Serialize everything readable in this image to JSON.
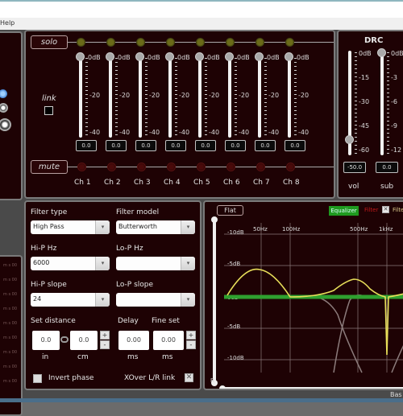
{
  "menu": {
    "help": "Help"
  },
  "mixer": {
    "solo_label": "solo",
    "mute_label": "mute",
    "link_label": "link",
    "scale": [
      "0dB",
      "-20",
      "-40"
    ],
    "channels": [
      {
        "name": "Ch 1",
        "value": "0.0",
        "level_db": 0
      },
      {
        "name": "Ch 2",
        "value": "0.0",
        "level_db": 0
      },
      {
        "name": "Ch 3",
        "value": "0.0",
        "level_db": 0
      },
      {
        "name": "Ch 4",
        "value": "0.0",
        "level_db": 0
      },
      {
        "name": "Ch 5",
        "value": "0.0",
        "level_db": 0
      },
      {
        "name": "Ch 6",
        "value": "0.0",
        "level_db": 0
      },
      {
        "name": "Ch 7",
        "value": "0.0",
        "level_db": 0
      },
      {
        "name": "Ch 8",
        "value": "0.0",
        "level_db": 0
      }
    ]
  },
  "drc": {
    "title": "DRC",
    "vol": {
      "label": "vol",
      "value": "-50.0",
      "level_db": -50,
      "scale": [
        "0dB",
        "-15",
        "-30",
        "-45",
        "-60"
      ]
    },
    "sub": {
      "label": "sub",
      "value": "0.0",
      "level_db": 0,
      "scale": [
        "0dB",
        "-3",
        "-6",
        "-9",
        "-12"
      ]
    }
  },
  "filter": {
    "filter_type_label": "Filter type",
    "filter_type_value": "High Pass",
    "filter_model_label": "Filter model",
    "filter_model_value": "Butterworth",
    "hip_hz_label": "Hi-P Hz",
    "hip_hz_value": "6000",
    "lop_hz_label": "Lo-P Hz",
    "lop_hz_value": "",
    "hip_slope_label": "Hi-P slope",
    "hip_slope_value": "24",
    "lop_slope_label": "Lo-P slope",
    "lop_slope_value": "",
    "set_distance_label": "Set distance",
    "delay_label": "Delay",
    "fine_set_label": "Fine set",
    "dist_in_value": "0.0",
    "dist_cm_value": "0.0",
    "delay_value": "0.00",
    "fine_value": "0.00",
    "unit_in": "in",
    "unit_cm": "cm",
    "unit_ms1": "ms",
    "unit_ms2": "ms",
    "plus": "+",
    "minus": "-",
    "invert_phase_label": "Invert phase",
    "xover_label": "XOver L/R link",
    "dropdown_arrow": "▾"
  },
  "eq": {
    "flat_label": "Flat",
    "equalizer_label": "Equalizer",
    "filter_label": "Filter",
    "filter2_label": "Filte",
    "r_label": "R",
    "freq_labels": [
      "50Hz",
      "100Hz",
      "500Hz",
      "1kHz"
    ],
    "db_labels": [
      "-10dB",
      "-5dB",
      "0dB",
      "-5dB",
      "-10dB"
    ],
    "colors": {
      "eq": "#e8df5a",
      "flat": "#2fa02f",
      "filter": "#8c7c7c",
      "accent_green": "#1f9a1f",
      "filter_red": "#c21818"
    }
  },
  "left_list": {
    "items_text": "m s 00",
    "count": 9
  },
  "status": {
    "bass_label": "Bas"
  }
}
